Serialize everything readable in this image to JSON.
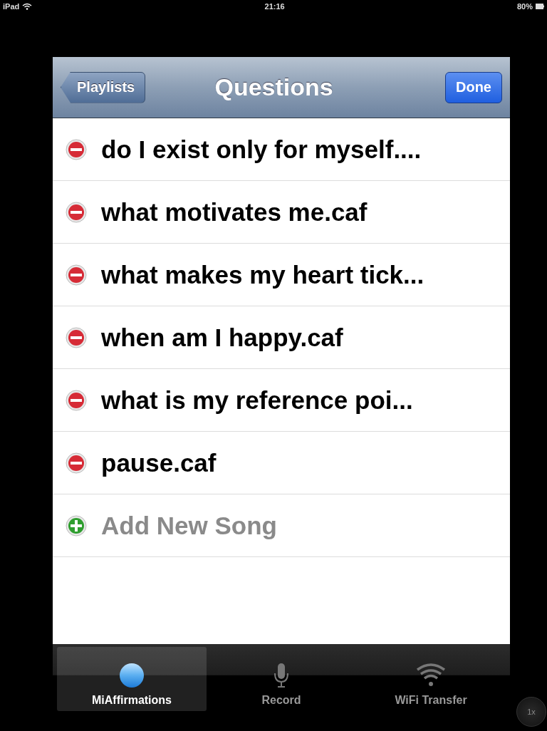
{
  "status_bar": {
    "device": "iPad",
    "time": "21:16",
    "battery": "80%"
  },
  "nav_bar": {
    "back_button": "Playlists",
    "title": "Questions",
    "done_button": "Done"
  },
  "rows": [
    {
      "kind": "delete",
      "label": "do I exist only for myself...."
    },
    {
      "kind": "delete",
      "label": "what motivates me.caf"
    },
    {
      "kind": "delete",
      "label": "what makes my heart tick..."
    },
    {
      "kind": "delete",
      "label": "when am I happy.caf"
    },
    {
      "kind": "delete",
      "label": "what is my reference poi..."
    },
    {
      "kind": "delete",
      "label": "pause.caf"
    },
    {
      "kind": "add",
      "label": "Add New Song"
    }
  ],
  "tabs": [
    {
      "kind": "sphere",
      "label": "MiAffirmations",
      "selected": true
    },
    {
      "kind": "microphone",
      "label": "Record",
      "selected": false
    },
    {
      "kind": "wifi",
      "label": "WiFi Transfer",
      "selected": false
    }
  ],
  "zoom_button": "1x"
}
